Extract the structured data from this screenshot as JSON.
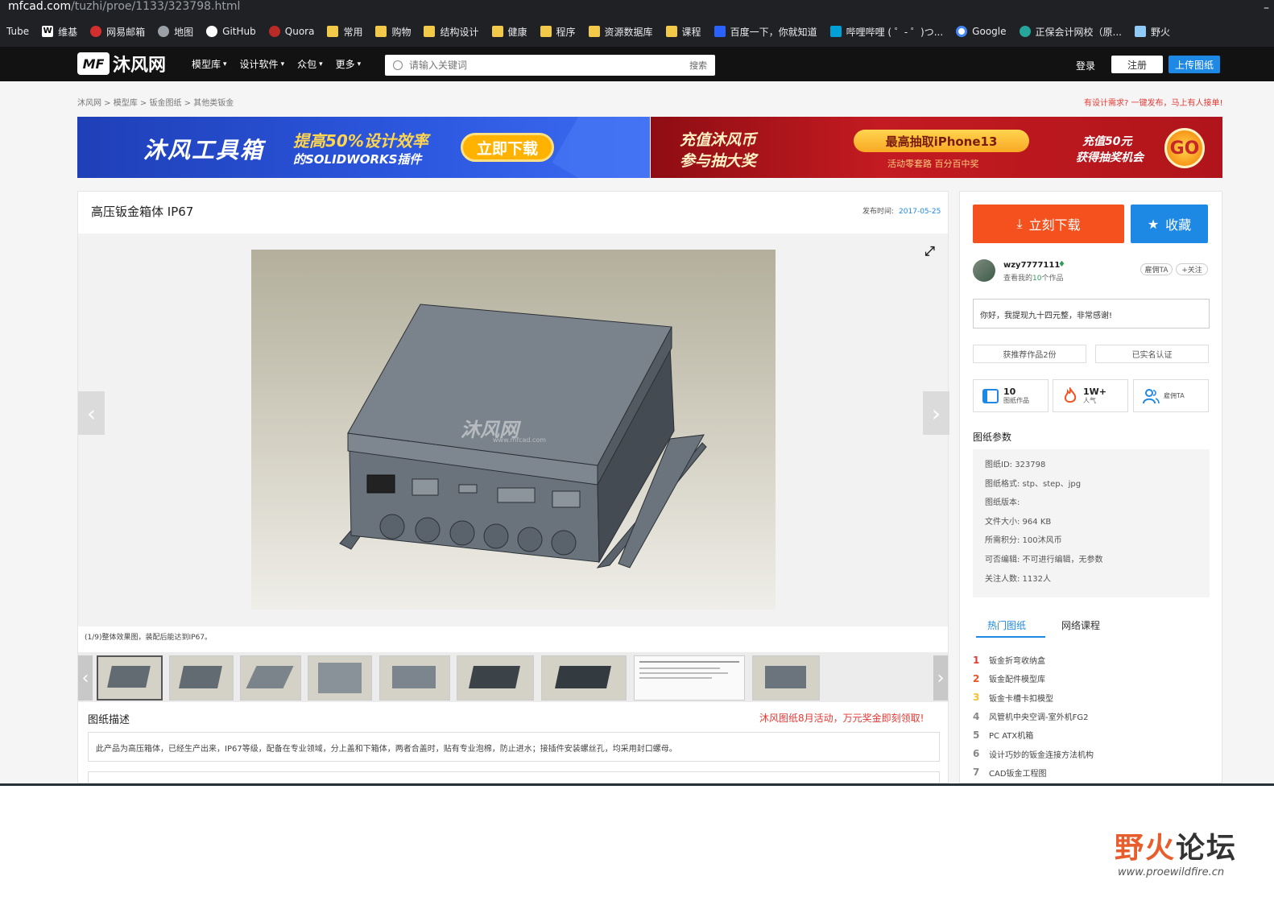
{
  "browser": {
    "url_host": "mfcad.com",
    "url_path": "/tuzhi/proe/1133/323798.html",
    "bookmarks": [
      "Tube",
      "维基",
      "网易邮箱",
      "地图",
      "GitHub",
      "Quora",
      "常用",
      "购物",
      "结构设计",
      "健康",
      "程序",
      "资源数据库",
      "课程",
      "百度一下，你就知道",
      "哔哩哔哩 ( ゜- ゜)つ...",
      "Google",
      "正保会计网校（原...",
      "野火"
    ]
  },
  "site": {
    "logo_text": "沐风网",
    "logo_mark": "MF",
    "nav": [
      "模型库",
      "设计软件",
      "众包",
      "更多"
    ],
    "search_placeholder": "请输入关键词",
    "search_button": "搜索",
    "login": "登录",
    "register": "注册",
    "upload": "上传图纸"
  },
  "breadcrumb": "沐风网 > 模型库 > 钣金图纸 > 其他类钣金",
  "demand_link": "有设计需求? 一键发布，马上有人接单!",
  "banners": {
    "left_title": "沐风工具箱",
    "left_sub1": "提高50%设计效率",
    "left_sub2": "的SOLIDWORKS插件",
    "left_btn": "立即下载",
    "right_t1": "充值沐风币",
    "right_t2": "参与抽大奖",
    "right_pill": "最高抽取iPhone13",
    "right_pill_sub": "活动零套路  百分百中奖",
    "right_t3": "充值50元",
    "right_t4": "获得抽奖机会",
    "right_go": "GO"
  },
  "item": {
    "title": "高压钣金箱体 IP67",
    "pub_label": "发布时间:",
    "pub_date": "2017-05-25",
    "watermark": "沐风网",
    "watermark_url": "www.mfcad.com",
    "caption": "(1/9)整体效果图，装配后能达到IP67。",
    "desc_title": "图纸描述",
    "promo": "沐风图纸8月活动，万元奖金即刻领取!",
    "description": "此产品为高压箱体，已经生产出来，IP67等级，配备在专业领域，分上盖和下箱体，两者合盖时，贴有专业泡棉，防止进水；接插件安装螺丝孔，均采用封口螺母。"
  },
  "side": {
    "download": "立刻下载",
    "favorite": "收藏",
    "username": "wzy7777111",
    "works_prefix": "查看我的",
    "works_count": "10",
    "works_suffix": "个作品",
    "hire": "雇佣TA",
    "follow": "+关注",
    "message": "你好，我提现九十四元整，非常感谢!",
    "tag_recommend": "获推荐作品2份",
    "tag_verified": "已实名认证",
    "stats": [
      {
        "value": "10",
        "label": "图纸作品"
      },
      {
        "value": "1W+",
        "label": "人气"
      },
      {
        "value": "",
        "label": "雇佣TA"
      }
    ],
    "param_title": "图纸参数",
    "params": [
      "图纸ID: 323798",
      "图纸格式: stp、step、jpg",
      "图纸版本:",
      "文件大小: 964 KB",
      "所需积分: 100沐风币",
      "可否编辑: 不可进行编辑，无参数",
      "关注人数: 1132人"
    ],
    "tab_hot": "热门图纸",
    "tab_course": "网络课程",
    "hot_list": [
      "钣金折弯收纳盒",
      "钣金配件模型库",
      "钣金卡槽卡扣模型",
      "风管机中央空调-室外机FG2",
      "PC ATX机箱",
      "设计巧妙的钣金连接方法机构",
      "CAD钣金工程图"
    ]
  },
  "forum_watermark": {
    "text_a": "野火",
    "text_b": "论坛",
    "url": "www.proewildfire.cn"
  }
}
